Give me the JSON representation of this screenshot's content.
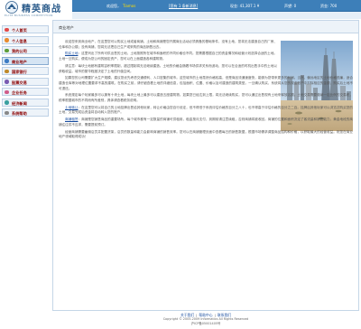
{
  "site": {
    "title": "精英商战",
    "subtitle": "ELITE BUSINESS COMPETITION"
  },
  "topbar": {
    "welcome": "欢迎您，",
    "username": "Tiamos",
    "message_link": "[您有 1 条新消息]",
    "cash": "现金: 41,307.1 ¥",
    "fame": "声望: 0",
    "assets": "资金: 700"
  },
  "sidebar": {
    "items": [
      {
        "label": "个人首页",
        "icon_color": "#e24a4a"
      },
      {
        "label": "个人信息",
        "icon_color": "#e98b2e"
      },
      {
        "label": "我的公司",
        "icon_color": "#5d9e3a"
      },
      {
        "label": "商业地产",
        "icon_color": "#3c7cc4"
      },
      {
        "label": "国家银行",
        "icon_color": "#c08a2a"
      },
      {
        "label": "股票交易",
        "icon_color": "#7a5bb2"
      },
      {
        "label": "企业任务",
        "icon_color": "#d05c8a"
      },
      {
        "label": "经济新闻",
        "icon_color": "#3aa0a0"
      },
      {
        "label": "系统帮助",
        "icon_color": "#888888"
      }
    ],
    "active_index": 3
  },
  "main": {
    "breadcrumb": "商业地产",
    "paragraphs": [
      {
        "before": "欢迎您来到商业地产，在这里您可以购买土地或者商铺。土地和商铺是您开展商业活动必须具备的基础条件，没有土地，您将无法建造自己的厂房、仓库和办公楼；没有商铺，您将无法把自己生产或采购的商品销售出去。",
        "link": "",
        "after": ""
      },
      {
        "before": "",
        "link": "购买土地",
        "after": "：这里列出了所有可供出售的土地，土地按照所在城市和面积的不同价格也不同。您需要根据自己的资金情况和经营计划选择合适的土地。土地一旦购买，便成为您公司的固定资产，您可以在上面建造各种建筑物。"
      },
      {
        "before": "请注意：每块土地都有建筑容积率限制，超过限制将无法继续建造。土地的价格会随着市场供求关系而波动，您可以在合适的时机出售手中的土地以获取收益。城市的繁华程度决定了土地的升值空间。",
        "link": "",
        "after": ""
      },
      {
        "before": "如果您的公司需要扩大生产规模，建议您优先考虑交通便利、人口密集的城市。这些城市的土地虽然价格较高，但是商品流通速度快，能够为您带来更多的利润。当然，偏远地区的土地价格低廉，适合建造仓库等对地理位置要求不高的建筑。在购买之前，请仔细查看土地的详细信息，包括面积、位置、价格以及可建造的建筑类型。一旦确认购买，系统将从您的现金账户中扣除相应的金额，购买后土地不可退还。",
        "link": "",
        "after": ""
      },
      {
        "before": "系统规定每个玩家最多可以拥有十块土地，每块土地上最多可以建造五座建筑物。如果您已经达到上限，将无法继续购买，您可以通过出售现有土地来释放名额。土地交易需要缴纳一定比例的交易税，税率根据城市的不同而有所差别，具体请查看税务说明。",
        "link": "",
        "after": ""
      },
      {
        "before": "",
        "link": "土地转让",
        "after": "：在这里您可以将自己的土地挂牌出售给其他玩家，转让价格由您自行设定，但不得低于系统评估价格的百分之八十，也不得高于评估价格的百分之二百。挂牌后其他玩家可以浏览并购买您的土地，交易完成后资金将自动转入您的账户。"
      },
      {
        "before": "",
        "link": "商铺租赁",
        "after": "：商铺是您销售商品的重要场所。每个城市都有一定数量的商铺可供租用，租金按月支付，到期前请注意续租，否则商铺将被收回。商铺的位置和面积决定了客流量和销售能力，黄金地段的商铺往往供不应求，需要提前预订。"
      },
      {
        "before": "经营商铺需要雇佣店员并配置货架，店员的数量和能力会影响商铺的销售效率。您可以在商铺管理页面中查看每日的销售数据，根据市场需求调整商品结构和价格，以获取最大的经营收益。祝您在商业地产领域取得成功！",
        "link": "",
        "after": ""
      }
    ]
  },
  "footer": {
    "links": [
      "关于我们",
      "帮助中心",
      "联系我们"
    ],
    "copyright": "Copyright © 2005-2009 Informatics All Rights Reserved",
    "icp": "沪ICP备05001405号"
  }
}
